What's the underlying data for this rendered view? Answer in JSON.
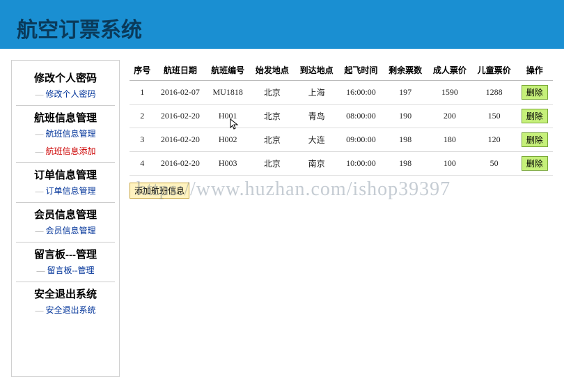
{
  "header": {
    "title": "航空订票系统"
  },
  "sidebar": {
    "groups": [
      {
        "title": "修改个人密码",
        "links": [
          {
            "label": "修改个人密码",
            "active": false,
            "name": "link-change-password"
          }
        ]
      },
      {
        "title": "航班信息管理",
        "links": [
          {
            "label": "航班信息管理",
            "active": false,
            "name": "link-flight-manage"
          },
          {
            "label": "航班信息添加",
            "active": true,
            "name": "link-flight-add"
          }
        ]
      },
      {
        "title": "订单信息管理",
        "links": [
          {
            "label": "订单信息管理",
            "active": false,
            "name": "link-order-manage"
          }
        ]
      },
      {
        "title": "会员信息管理",
        "links": [
          {
            "label": "会员信息管理",
            "active": false,
            "name": "link-member-manage"
          }
        ]
      },
      {
        "title": "留言板---管理",
        "links": [
          {
            "label": "留言板--管理",
            "active": false,
            "name": "link-message-manage"
          }
        ]
      },
      {
        "title": "安全退出系统",
        "links": [
          {
            "label": "安全退出系统",
            "active": false,
            "name": "link-logout"
          }
        ]
      }
    ]
  },
  "table": {
    "headers": {
      "seq": "序号",
      "date": "航班日期",
      "flight": "航班编号",
      "origin": "始发地点",
      "dest": "到达地点",
      "depart": "起飞时间",
      "tickets": "剩余票数",
      "adult": "成人票价",
      "child": "儿童票价",
      "op": "操作"
    },
    "rows": [
      {
        "seq": "1",
        "date": "2016-02-07",
        "flight": "MU1818",
        "origin": "北京",
        "dest": "上海",
        "depart": "16:00:00",
        "tickets": "197",
        "adult": "1590",
        "child": "1288"
      },
      {
        "seq": "2",
        "date": "2016-02-20",
        "flight": "H001",
        "origin": "北京",
        "dest": "青岛",
        "depart": "08:00:00",
        "tickets": "190",
        "adult": "200",
        "child": "150"
      },
      {
        "seq": "3",
        "date": "2016-02-20",
        "flight": "H002",
        "origin": "北京",
        "dest": "大连",
        "depart": "09:00:00",
        "tickets": "198",
        "adult": "180",
        "child": "120"
      },
      {
        "seq": "4",
        "date": "2016-02-20",
        "flight": "H003",
        "origin": "北京",
        "dest": "南京",
        "depart": "10:00:00",
        "tickets": "198",
        "adult": "100",
        "child": "50"
      }
    ],
    "deleteLabel": "删除",
    "addLabel": "添加航班信息"
  },
  "watermark": "https://www.huzhan.com/ishop39397"
}
